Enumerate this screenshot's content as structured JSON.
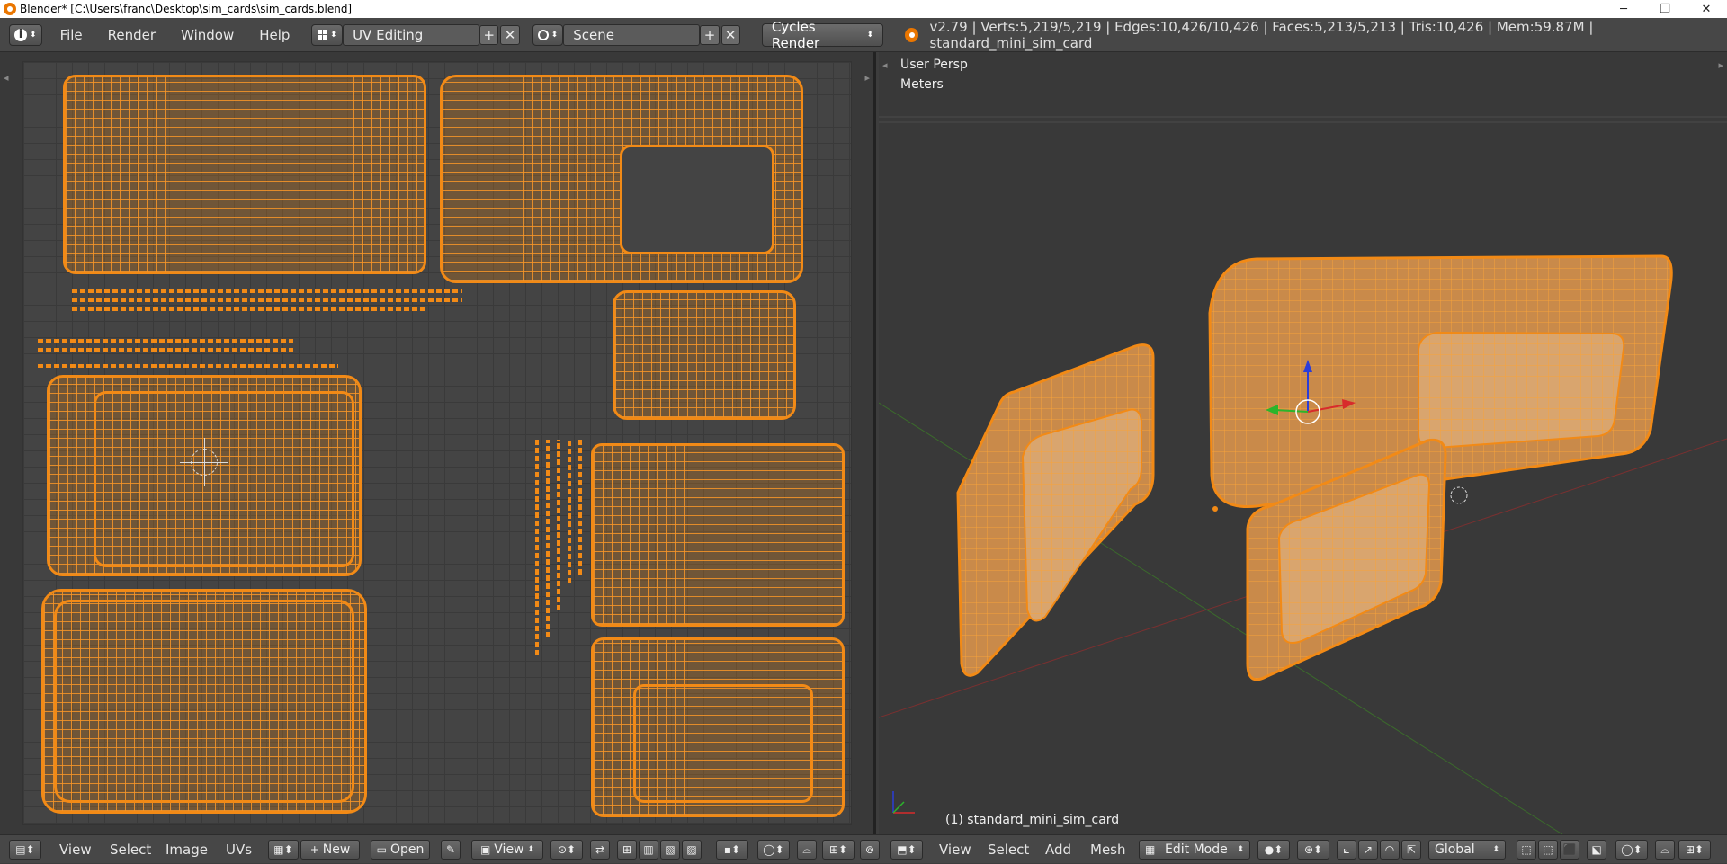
{
  "window": {
    "title": "Blender* [C:\\Users\\franc\\Desktop\\sim_cards\\sim_cards.blend]",
    "minimize": "─",
    "restore": "❐",
    "close": "✕"
  },
  "topbar": {
    "info_icon": "i",
    "menus": [
      "File",
      "Render",
      "Window",
      "Help"
    ],
    "screen_layout": "UV Editing",
    "scene": "Scene",
    "render_engine": "Cycles Render",
    "stats": "v2.79 | Verts:5,219/5,219 | Edges:10,426/10,426 | Faces:5,213/5,213 | Tris:10,426 | Mem:59.87M | standard_mini_sim_card",
    "add_symbol": "+",
    "close_symbol": "✕"
  },
  "viewport": {
    "view_name": "User Persp",
    "units": "Meters",
    "object_label": "(1) standard_mini_sim_card"
  },
  "uv_header": {
    "menus": [
      "View",
      "Select",
      "Image",
      "UVs"
    ],
    "new_label": "New",
    "open_label": "Open",
    "view_label": "View"
  },
  "view3d_header": {
    "menus": [
      "View",
      "Select",
      "Add",
      "Mesh"
    ],
    "mode": "Edit Mode",
    "orientation": "Global"
  },
  "colors": {
    "accent": "#f28a16",
    "background": "#393939",
    "header": "#474747"
  }
}
